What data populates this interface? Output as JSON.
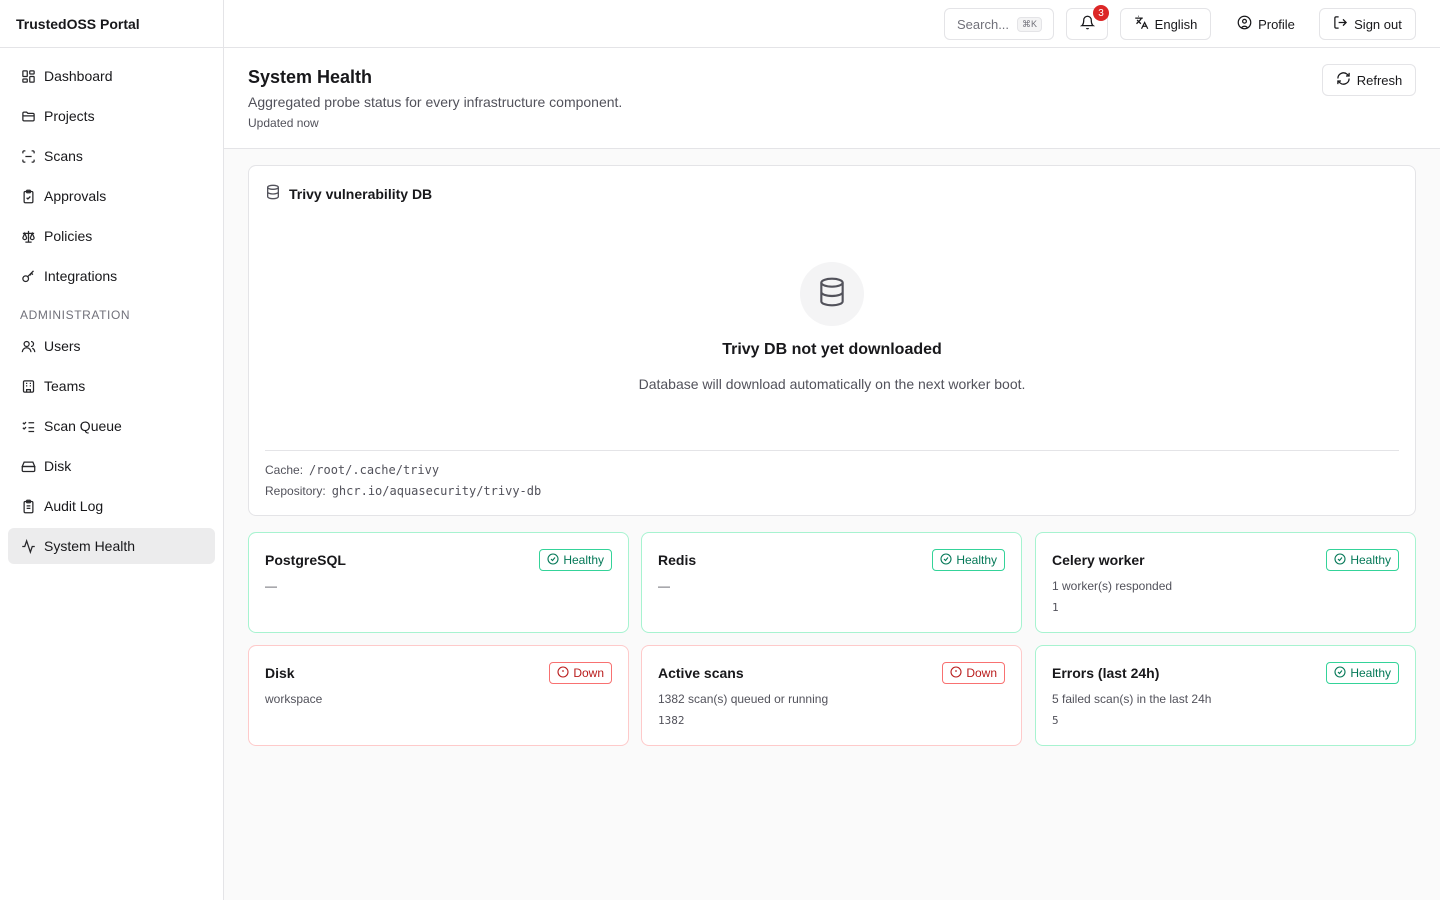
{
  "app": {
    "brand": "TrustedOSS Portal"
  },
  "sidebar": {
    "items": [
      {
        "label": "Dashboard",
        "icon": "dashboard-icon"
      },
      {
        "label": "Projects",
        "icon": "folder-icon"
      },
      {
        "label": "Scans",
        "icon": "scan-icon"
      },
      {
        "label": "Approvals",
        "icon": "clipboard-check-icon"
      },
      {
        "label": "Policies",
        "icon": "scale-icon"
      },
      {
        "label": "Integrations",
        "icon": "key-icon"
      }
    ],
    "admin_section": "ADMINISTRATION",
    "admin_items": [
      {
        "label": "Users",
        "icon": "users-icon"
      },
      {
        "label": "Teams",
        "icon": "building-icon"
      },
      {
        "label": "Scan Queue",
        "icon": "list-checks-icon"
      },
      {
        "label": "Disk",
        "icon": "hard-drive-icon"
      },
      {
        "label": "Audit Log",
        "icon": "clipboard-list-icon"
      },
      {
        "label": "System Health",
        "icon": "activity-icon",
        "active": true
      }
    ]
  },
  "topbar": {
    "search_placeholder": "Search...",
    "search_shortcut": "⌘K",
    "notifications_count": "3",
    "language": "English",
    "profile": "Profile",
    "signout": "Sign out"
  },
  "header": {
    "title": "System Health",
    "subtitle": "Aggregated probe status for every infrastructure component.",
    "updated": "Updated now",
    "refresh": "Refresh"
  },
  "trivy": {
    "title": "Trivy vulnerability DB",
    "empty_title": "Trivy DB not yet downloaded",
    "empty_desc": "Database will download automatically on the next worker boot.",
    "cache_label": "Cache:",
    "cache_value": "/root/.cache/trivy",
    "repo_label": "Repository:",
    "repo_value": "ghcr.io/aquasecurity/trivy-db"
  },
  "cards": [
    {
      "title": "PostgreSQL",
      "status": "Healthy",
      "state": "healthy",
      "detail": "—",
      "value": ""
    },
    {
      "title": "Redis",
      "status": "Healthy",
      "state": "healthy",
      "detail": "—",
      "value": ""
    },
    {
      "title": "Celery worker",
      "status": "Healthy",
      "state": "healthy",
      "detail": "1 worker(s) responded",
      "value": "1"
    },
    {
      "title": "Disk",
      "status": "Down",
      "state": "down",
      "detail": "workspace",
      "value": ""
    },
    {
      "title": "Active scans",
      "status": "Down",
      "state": "down",
      "detail": "1382 scan(s) queued or running",
      "value": "1382"
    },
    {
      "title": "Errors (last 24h)",
      "status": "Healthy",
      "state": "healthy",
      "detail": "5 failed scan(s) in the last 24h",
      "value": "5"
    }
  ],
  "colors": {
    "healthy": "#047857",
    "down": "#b91c1c",
    "badge": "#dc2626"
  }
}
